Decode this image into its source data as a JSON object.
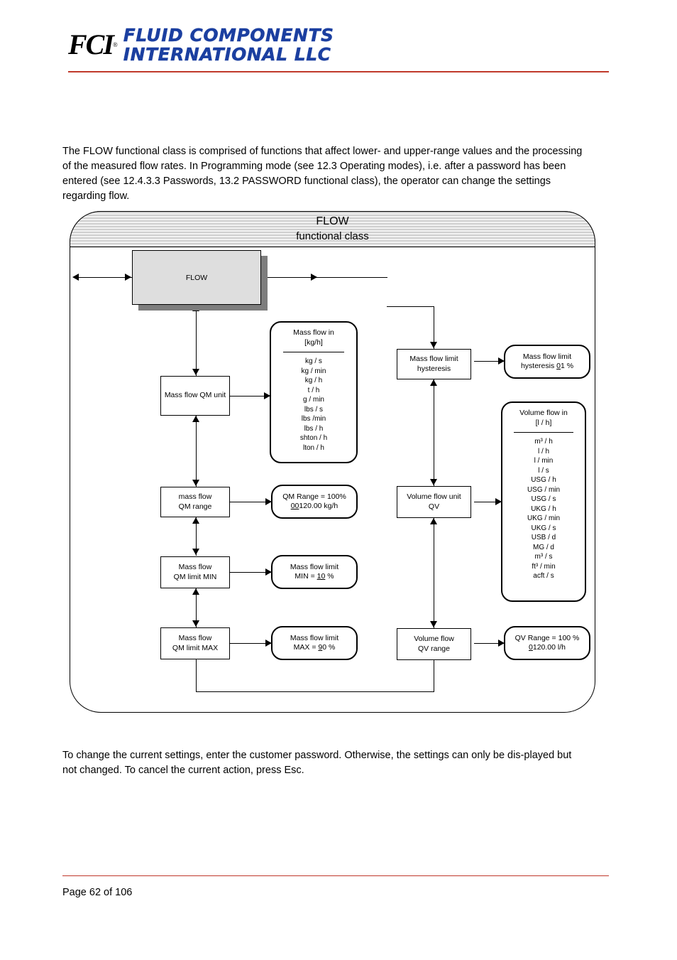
{
  "header": {
    "logo_mark": "FCI",
    "logo_reg": "®",
    "logo_line1": "FLUID COMPONENTS",
    "logo_line2": "INTERNATIONAL LLC"
  },
  "intro_paragraph": "The FLOW functional class is comprised of functions that affect lower- and upper-range values and the processing of the measured flow rates. In Programming mode (see 12.3 Operating modes), i.e. after a password has been entered (see 12.4.3.3 Passwords, 13.2 PASSWORD functional class), the operator can change the settings regarding flow.",
  "closing_paragraph": "To change the current settings, enter the customer password. Otherwise, the settings can only be dis-played but not changed. To cancel the current action, press Esc.",
  "footer": {
    "page_number": "Page 62 of 106"
  },
  "diagram": {
    "title_line1": "FLOW",
    "title_line2": "functional class",
    "flow_block": "FLOW",
    "nodes": {
      "mass_flow_qm_unit": "Mass flow QM unit",
      "mass_flow_in_header_1": "Mass flow in",
      "mass_flow_in_header_2": "[kg/h]",
      "mass_flow_units": [
        "kg / s",
        "kg / min",
        "kg / h",
        "t / h",
        "g / min",
        "lbs / s",
        "lbs /min",
        "lbs / h",
        "shton / h",
        "lton / h"
      ],
      "mass_flow_qm_range_1": "mass flow",
      "mass_flow_qm_range_2": "QM range",
      "qm_range_value_1": "QM Range = 100%",
      "qm_range_value_2_underline": "00",
      "qm_range_value_2_rest": "120.00 kg/h",
      "mass_flow_qm_limit_min_1": "Mass flow",
      "mass_flow_qm_limit_min_2": "QM limit MIN",
      "mass_flow_limit_min_1": "Mass flow limit",
      "mass_flow_limit_min_2_pre": "MIN = ",
      "mass_flow_limit_min_2_underline": "10",
      "mass_flow_limit_min_2_post": " %",
      "mass_flow_qm_limit_max_1": "Mass flow",
      "mass_flow_qm_limit_max_2": "QM limit MAX",
      "mass_flow_limit_max_1": "Mass flow limit",
      "mass_flow_limit_max_2_pre": "MAX = ",
      "mass_flow_limit_max_2_underline": "9",
      "mass_flow_limit_max_2_post": "0 %",
      "mass_flow_limit_hysteresis_1": "Mass flow limit",
      "mass_flow_limit_hysteresis_2": "hysteresis",
      "mass_flow_limit_hysteresis_val_1": "Mass flow limit",
      "mass_flow_limit_hysteresis_val_2_pre": "hysteresis  ",
      "mass_flow_limit_hysteresis_val_2_underline": "0",
      "mass_flow_limit_hysteresis_val_2_post": "1 %",
      "volume_flow_unit_1": "Volume flow unit",
      "volume_flow_unit_2": "QV",
      "volume_flow_in_header_1": "Volume flow in",
      "volume_flow_in_header_2": "[l / h]",
      "volume_flow_units": [
        "m³ /  h",
        "l /  h",
        "l /  min",
        "l / s",
        "USG /  h",
        "USG /  min",
        "USG / s",
        "UKG /  h",
        "UKG / min",
        "UKG / s",
        "USB / d",
        "MG / d",
        "m³ / s",
        "ft³ / min",
        "acft / s"
      ],
      "volume_flow_qv_range_1": "Volume flow",
      "volume_flow_qv_range_2": "QV range",
      "qv_range_value_1": "QV Range = 100 %",
      "qv_range_value_2_underline": "0",
      "qv_range_value_2_rest": "120.00 l/h"
    }
  }
}
